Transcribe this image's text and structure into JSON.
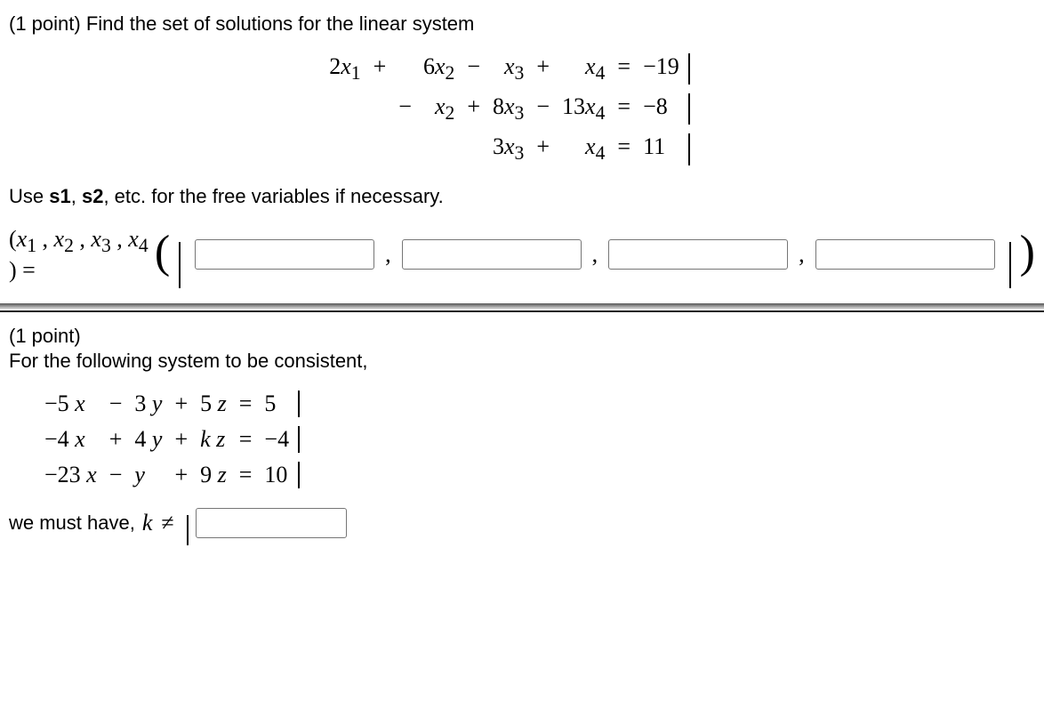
{
  "problem1": {
    "points": "(1 point)",
    "prompt_rest": " Find the set of solutions for the linear system",
    "system": {
      "rows": [
        {
          "c1": "2x",
          "s1": "1",
          "op1": "+",
          "c2": "6x",
          "s2": "2",
          "op2": "−",
          "c3": "x",
          "s3": "3",
          "op3": "+",
          "c4": "x",
          "s4": "4",
          "eq": "=",
          "rhs": "−19"
        },
        {
          "c1": "",
          "s1": "",
          "op1": "",
          "c2": "−",
          "s2": "",
          "c2b": "x",
          "s2b": "2",
          "op2": "+",
          "c3": "8x",
          "s3": "3",
          "op3": "−",
          "c4": "13x",
          "s4": "4",
          "eq": "=",
          "rhs": "−8"
        },
        {
          "c1": "",
          "s1": "",
          "op1": "",
          "c2": "",
          "s2": "",
          "op2": "",
          "c3": "3x",
          "s3": "3",
          "op3": "+",
          "c4": "x",
          "s4": "4",
          "eq": "=",
          "rhs": "11"
        }
      ]
    },
    "instruction_pre": "Use ",
    "s1": "s1",
    "instruction_mid": ", ",
    "s2": "s2",
    "instruction_post": ", etc. for the free variables if necessary.",
    "answer_lhs_a": "(x",
    "answer_lhs_b": " , x",
    "answer_lhs_c": " , x",
    "answer_lhs_d": " , x",
    "answer_lhs_e": " ) = ",
    "sub1": "1",
    "sub2": "2",
    "sub3": "3",
    "sub4": "4",
    "paren_open": "(",
    "paren_close": ")",
    "comma": ","
  },
  "problem2": {
    "points": "(1 point)",
    "prompt": "For the following system to be consistent,",
    "system": {
      "rows": [
        {
          "c1": "−5 x",
          "op1": "−",
          "c2": "3 y",
          "op2": "+",
          "c3": "5 z",
          "eq": "=",
          "rhs": "5"
        },
        {
          "c1": "−4 x",
          "op1": "+",
          "c2": "4 y",
          "op2": "+",
          "c3": "k z",
          "eq": "=",
          "rhs": "−4"
        },
        {
          "c1": "−23 x",
          "op1": "−",
          "c2": "y",
          "op2": "+",
          "c3": "9 z",
          "eq": "=",
          "rhs": "10"
        }
      ]
    },
    "final_pre": "we must have, ",
    "kvar": "k",
    "neq": "≠"
  }
}
